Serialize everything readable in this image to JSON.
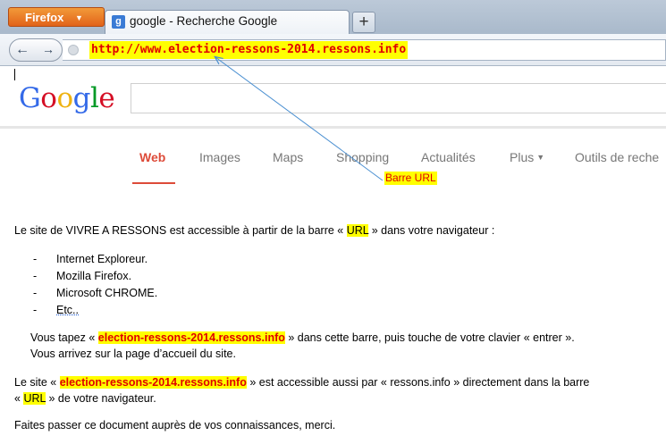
{
  "browser": {
    "menu_button": "Firefox",
    "tab_title": "google - Recherche Google",
    "tab_favicon": "g",
    "new_tab_label": "+",
    "back_label": "←",
    "forward_label": "→",
    "url": "http://www.election-ressons-2014.ressons.info"
  },
  "google": {
    "logo": [
      "G",
      "o",
      "o",
      "g",
      "l",
      "e"
    ],
    "logo_colors": [
      "#3369e8",
      "#d50f25",
      "#eeb211",
      "#3369e8",
      "#009925",
      "#d50f25"
    ],
    "tabs": [
      "Web",
      "Images",
      "Maps",
      "Shopping",
      "Actualités",
      "Plus",
      "Outils de reche"
    ],
    "active_tab_color": "#dd4b39"
  },
  "annotation": {
    "label": "Barre URL",
    "arrow_color": "#4a8fd1"
  },
  "doc": {
    "para1_a": "Le site de VIVRE A RESSONS est accessible à partir de la barre « ",
    "para1_url": "URL",
    "para1_b": " » dans votre navigateur :",
    "bullets": [
      "Internet Exploreur.",
      "Mozilla Firefox.",
      "Microsoft CHROME.",
      "Etc.."
    ],
    "bullet_dash": "-",
    "para2_a": "Vous tapez « ",
    "para2_site": "election-ressons-2014.ressons.info",
    "para2_b": " » dans cette barre, puis touche de votre clavier « entrer ».",
    "para2_line2": "Vous arrivez sur la page d’accueil du site.",
    "para3_a": "Le site « ",
    "para3_site": "election-ressons-2014.ressons.info",
    "para3_b": " » est accessible aussi par « ressons.info » directement dans la barre",
    "para3_c": "« ",
    "para3_url": "URL",
    "para3_d": " » de votre navigateur.",
    "para4": "Faites passer ce document auprès de vos connaissances, merci."
  }
}
